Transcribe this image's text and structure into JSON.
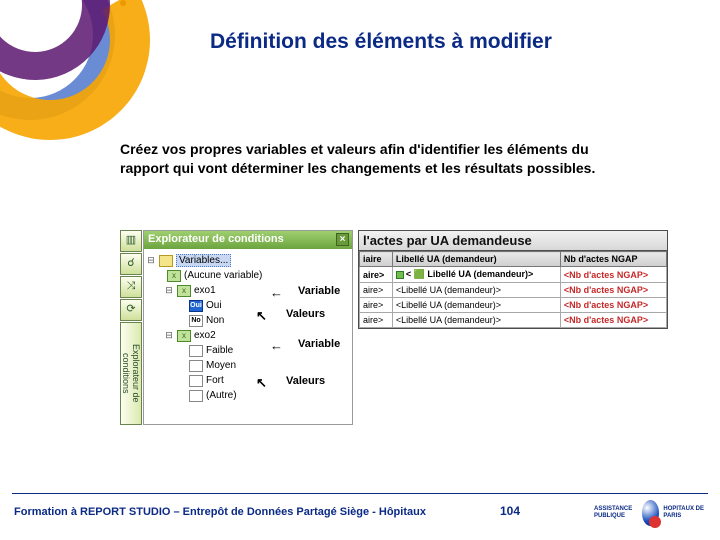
{
  "title": "Définition des éléments à modifier",
  "subtitle": "Créez vos propres variables et valeurs afin d'identifier les éléments du rapport qui vont déterminer les changements et les résultats possibles.",
  "toolbar": {
    "vtab_label": "Explorateur de conditions"
  },
  "panel": {
    "header": "Explorateur de conditions",
    "root": "Variables...",
    "items": [
      {
        "label": "(Aucune variable)"
      },
      {
        "label": "exo1"
      },
      {
        "label": "Oui",
        "cls": "b-oui"
      },
      {
        "label": "Non",
        "cls": "b-non"
      },
      {
        "label": "exo2"
      },
      {
        "label": "Faible",
        "cls": "b-non"
      },
      {
        "label": "Moyen",
        "cls": "b-non"
      },
      {
        "label": "Fort",
        "cls": "b-non"
      },
      {
        "label": "(Autre)",
        "cls": "b-non"
      }
    ]
  },
  "annot": {
    "var1": "Variable",
    "val1": "Valeurs",
    "var2": "Variable",
    "val2": "Valeurs"
  },
  "grid": {
    "title": "l'actes par UA demandeuse",
    "headers": [
      "iaire",
      "Libellé UA (demandeur)",
      "Nb d'actes NGAP"
    ],
    "rows": [
      [
        "aire>",
        "< 🟩 Libellé UA (demandeur)>",
        "<Nb d'actes NGAP>"
      ],
      [
        "aire>",
        "<Libellé UA (demandeur)>",
        "<Nb d'actes NGAP>"
      ],
      [
        "aire>",
        "<Libellé UA (demandeur)>",
        "<Nb d'actes NGAP>"
      ],
      [
        "aire>",
        "<Libellé UA (demandeur)>",
        "<Nb d'actes NGAP>"
      ]
    ]
  },
  "footer": {
    "text": "Formation à REPORT STUDIO – Entrepôt de Données Partagé Siège - Hôpitaux",
    "page": "104",
    "logo1": "ASSISTANCE PUBLIQUE",
    "logo2": "HOPITAUX DE PARIS"
  }
}
